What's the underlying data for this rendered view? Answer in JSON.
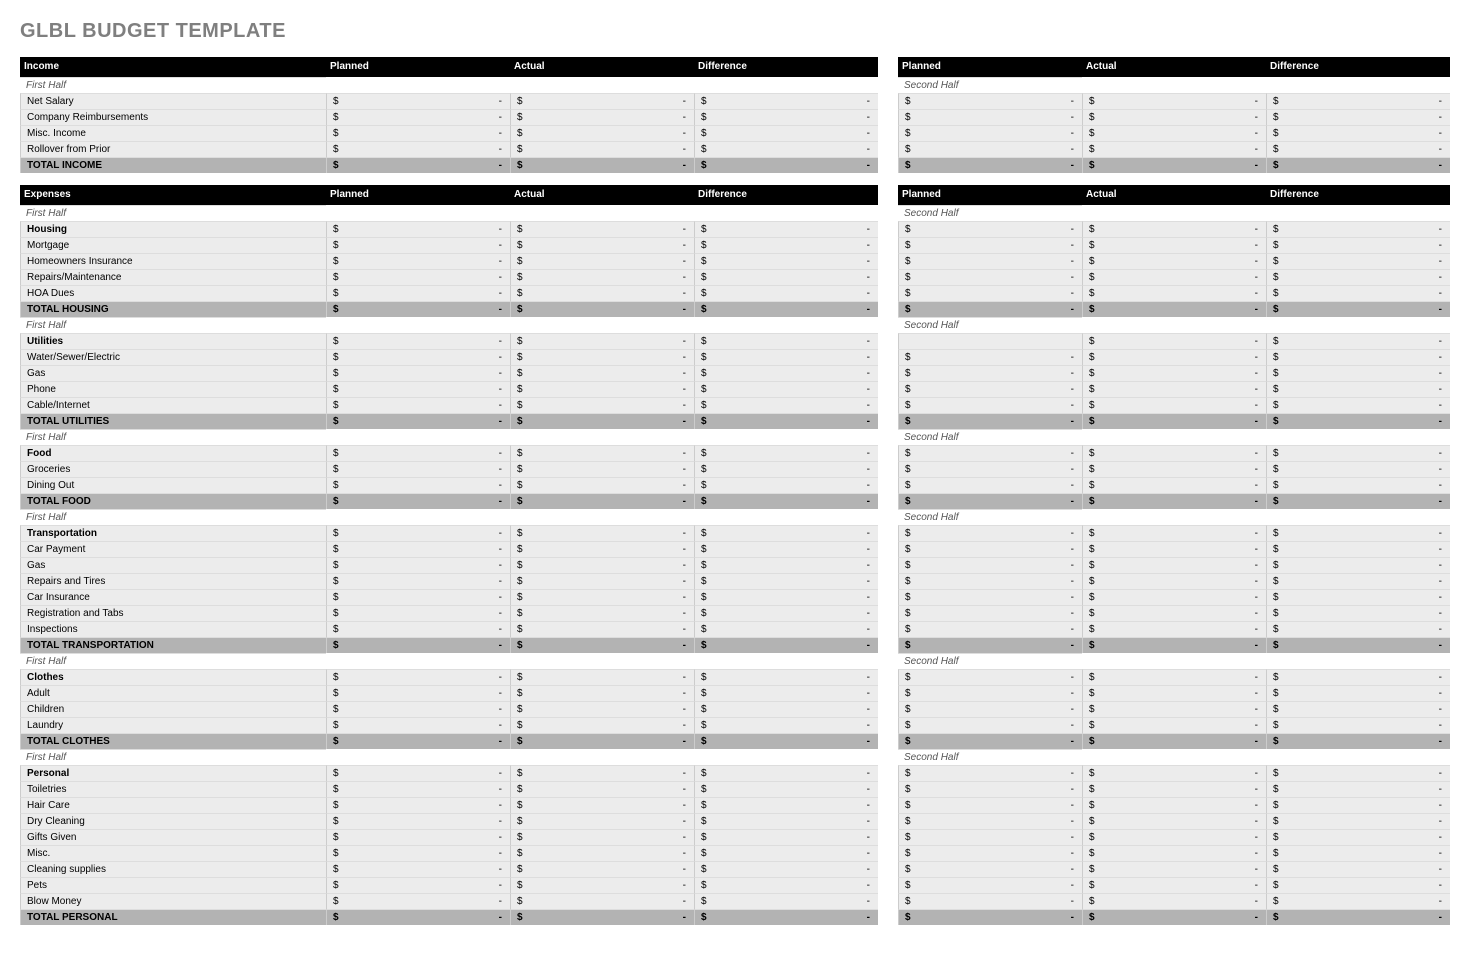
{
  "title": "GLBL BUDGET TEMPLATE",
  "columns": {
    "planned": "Planned",
    "actual": "Actual",
    "difference": "Difference"
  },
  "half_labels": {
    "first": "First Half",
    "second": "Second Half"
  },
  "currency": "$",
  "empty": "-",
  "sections": [
    {
      "header_label": "Income",
      "groups": [
        {
          "subheader": true,
          "category": null,
          "rows": [
            "Net Salary",
            "Company Reimbursements",
            "Misc. Income",
            "Rollover from Prior"
          ],
          "total": "TOTAL INCOME"
        }
      ]
    },
    {
      "header_label": "Expenses",
      "groups": [
        {
          "subheader": true,
          "category": "Housing",
          "rows": [
            "Mortgage",
            "Homeowners Insurance",
            "Repairs/Maintenance",
            "HOA Dues"
          ],
          "total": "TOTAL HOUSING"
        },
        {
          "subheader": true,
          "category": "Utilities",
          "rows": [
            "Water/Sewer/Electric",
            "Gas",
            "Phone",
            "Cable/Internet"
          ],
          "total": "TOTAL UTILITIES",
          "second_half_first_cell_blank": true
        },
        {
          "subheader": true,
          "category": "Food",
          "rows": [
            "Groceries",
            "Dining Out"
          ],
          "total": "TOTAL FOOD"
        },
        {
          "subheader": true,
          "category": "Transportation",
          "rows": [
            "Car Payment",
            "Gas",
            "Repairs and Tires",
            "Car Insurance",
            "Registration and Tabs",
            "Inspections"
          ],
          "total": "TOTAL TRANSPORTATION"
        },
        {
          "subheader": true,
          "category": "Clothes",
          "rows": [
            "Adult",
            "Children",
            "Laundry"
          ],
          "total": "TOTAL CLOTHES"
        },
        {
          "subheader": true,
          "category": "Personal",
          "rows": [
            "Toiletries",
            "Hair Care",
            "Dry Cleaning",
            "Gifts Given",
            "Misc.",
            "Cleaning supplies",
            "Pets",
            "Blow Money"
          ],
          "total": "TOTAL PERSONAL"
        }
      ]
    }
  ]
}
